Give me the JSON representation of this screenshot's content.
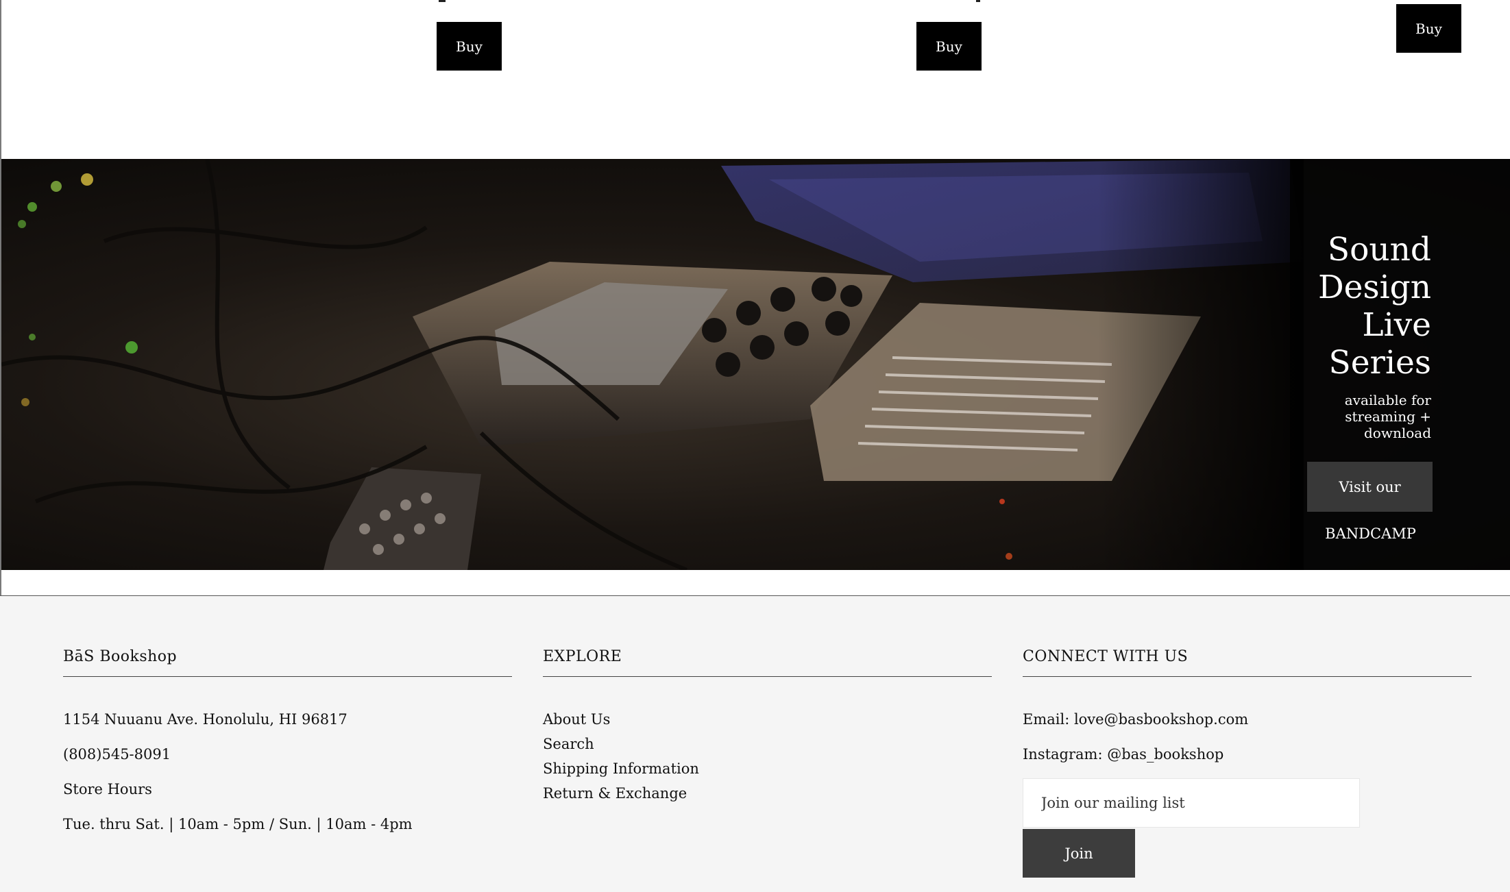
{
  "products": {
    "buy_labels": [
      "Buy",
      "Buy",
      "Buy"
    ]
  },
  "hero": {
    "title_lines": [
      "Sound",
      "Design",
      "Live",
      "Series"
    ],
    "subtitle_lines": [
      "available for",
      "streaming +",
      "download"
    ],
    "cta_label": "Visit our",
    "link_label": "BANDCAMP"
  },
  "footer": {
    "about": {
      "heading": "BāS Bookshop",
      "address": "1154 Nuuanu Ave. Honolulu, HI 96817",
      "phone": "(808)545-8091",
      "hours_label": "Store Hours",
      "hours": "Tue. thru Sat. | 10am - 5pm / Sun. | 10am - 4pm"
    },
    "explore": {
      "heading": "EXPLORE",
      "links": [
        "About Us",
        "Search",
        "Shipping Information",
        "Return & Exchange"
      ]
    },
    "connect": {
      "heading": "CONNECT WITH US",
      "email": "Email: love@basbookshop.com",
      "instagram": "Instagram: @bas_bookshop",
      "mailing_placeholder": "Join our mailing list",
      "join_label": "Join"
    }
  },
  "colors": {
    "button_black": "#000000",
    "hero_cta_bg": "#383838",
    "footer_bg": "#f5f5f5",
    "join_bg": "#3d3d3d"
  }
}
